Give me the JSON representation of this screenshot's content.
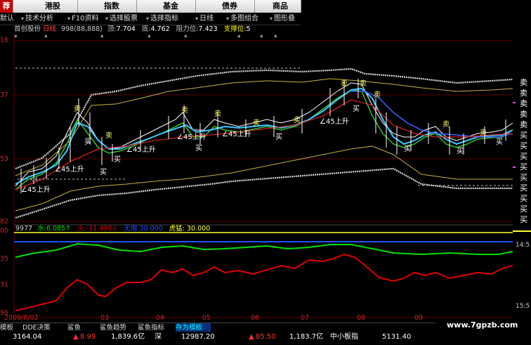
{
  "top_tabs": [
    {
      "label": "荐",
      "active": true
    },
    {
      "label": "港股"
    },
    {
      "label": "指数"
    },
    {
      "label": "基金"
    },
    {
      "label": "债券"
    },
    {
      "label": "商品"
    }
  ],
  "menu": [
    {
      "label": "默认"
    },
    {
      "label": "技术分析"
    },
    {
      "label": "F10资料"
    },
    {
      "label": "选择股票"
    },
    {
      "label": "选择指标"
    },
    {
      "label": "日线"
    },
    {
      "label": "多图组合"
    },
    {
      "label": "图形叠"
    }
  ],
  "info": {
    "stock": "首创股份",
    "period": "日线",
    "code": "998(88,888)",
    "top_label": "顶:",
    "top_value": "7.704",
    "bottom_label": "底:",
    "bottom_value": "4.762",
    "resist_label": "阻力位:",
    "resist_value": "7.423",
    "support_label": "支撑位:",
    "support_value": "5"
  },
  "y_labels": {
    "l1": "16",
    "l2": "37",
    "l3": "59",
    "l4": "82",
    "l5": "00",
    "l6": "35",
    "l7": "31",
    "l8": "96"
  },
  "right_labels": {
    "r1": "14:5",
    "r2": "15:5"
  },
  "signal_labels": {
    "sell": "卖",
    "buy": "买",
    "up45": "∠45上升",
    "mark": "04"
  },
  "indicator": {
    "code": "9977",
    "water_label": "水:",
    "water_value": "6.085↑",
    "fire_label": "火:",
    "fire_value": "-11.438↓",
    "gen_label": "无限",
    "gen_value": "30.000",
    "tiger_label": "虎猛:",
    "tiger_value": "30.000"
  },
  "x_axis": {
    "t0": "2009/8/02",
    "t1": "03",
    "t2": "04",
    "t3": "05",
    "t4": "06",
    "t5": "07",
    "t6": "08",
    "t7": "09"
  },
  "bottom_tabs": [
    {
      "label": "模板"
    },
    {
      "label": "DDE决策"
    },
    {
      "label": "鲨鱼"
    },
    {
      "label": "鲨鱼趋势"
    },
    {
      "label": "鲨鱼指标"
    },
    {
      "label": "存为模板",
      "active": true
    }
  ],
  "ticker": {
    "v1": "3164.04",
    "v2": "8.99",
    "v3": "1,839.6亿",
    "v4": "深",
    "v5": "12987.20",
    "v6": "85.50",
    "v7": "1,183.7亿",
    "v8": "中小板指",
    "v9": "5131.40"
  },
  "watermark": "www.7gpzb.com",
  "colors": {
    "water": "#00ff00",
    "fire": "#ff0000",
    "blue": "#2050ff",
    "yellow": "#ffff00",
    "price": "#ff3030"
  }
}
